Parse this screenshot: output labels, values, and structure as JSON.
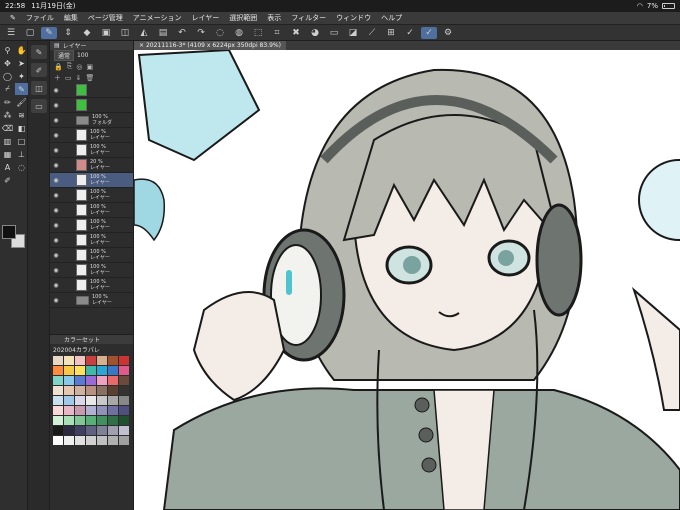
{
  "status_bar": {
    "time": "22:58",
    "date": "11月19日(金)",
    "battery": "7%",
    "battery_level": 0.07
  },
  "menu": [
    "ファイル",
    "編集",
    "ページ管理",
    "アニメーション",
    "レイヤー",
    "選択範囲",
    "表示",
    "フィルター",
    "ウィンドウ",
    "ヘルプ"
  ],
  "layer_panel": {
    "title": "レイヤー",
    "blend_mode": "通常",
    "opacity": "100",
    "layers": [
      {
        "pct": "",
        "name": "",
        "kind": "green"
      },
      {
        "pct": "",
        "name": "",
        "kind": "green"
      },
      {
        "pct": "100 %",
        "name": "フォルダ",
        "kind": "folder"
      },
      {
        "pct": "100 %",
        "name": "レイヤー",
        "kind": "thumb"
      },
      {
        "pct": "100 %",
        "name": "レイヤー",
        "kind": "thumb"
      },
      {
        "pct": "20 %",
        "name": "レイヤー",
        "kind": "red"
      },
      {
        "pct": "100 %",
        "name": "レイヤー",
        "kind": "thumb",
        "active": true
      },
      {
        "pct": "100 %",
        "name": "レイヤー",
        "kind": "thumb"
      },
      {
        "pct": "100 %",
        "name": "レイヤー",
        "kind": "thumb"
      },
      {
        "pct": "100 %",
        "name": "レイヤー",
        "kind": "thumb"
      },
      {
        "pct": "100 %",
        "name": "レイヤー",
        "kind": "thumb"
      },
      {
        "pct": "100 %",
        "name": "レイヤー",
        "kind": "thumb"
      },
      {
        "pct": "100 %",
        "name": "レイヤー",
        "kind": "thumb"
      },
      {
        "pct": "100 %",
        "name": "レイヤー",
        "kind": "thumb"
      },
      {
        "pct": "100 %",
        "name": "レイヤー",
        "kind": "folder"
      }
    ]
  },
  "color_panel": {
    "title": "カラーセット",
    "set_name": "202004カラパレ",
    "chips": [
      "#e8d9c6",
      "#f4e2b8",
      "#f2c3c3",
      "#c94040",
      "#d8b090",
      "#a0522d",
      "#cc3333",
      "#ff8c3c",
      "#f7c948",
      "#ffe25a",
      "#40b8a8",
      "#2aa6d6",
      "#3a78c6",
      "#e05a8a",
      "#7fd6c8",
      "#88c8e8",
      "#5a7ad6",
      "#9a6ad6",
      "#f0a0c0",
      "#e86a6a",
      "#6a4a3a",
      "#f0e0d0",
      "#e6c8b0",
      "#d0b0a0",
      "#b89080",
      "#8a7060",
      "#5a4030",
      "#333333",
      "#c8e0f0",
      "#a0c8e8",
      "#d8d8e8",
      "#e8e8e8",
      "#c8c8c8",
      "#a8a8a8",
      "#888888",
      "#f8d8d8",
      "#e8b8c8",
      "#c89ab0",
      "#b0b0d0",
      "#9090b8",
      "#7070a0",
      "#505080",
      "#d0f0d8",
      "#a8e0b8",
      "#80c898",
      "#58b078",
      "#409060",
      "#307048",
      "#205030",
      "#1a1a1a",
      "#2a2a40",
      "#404060",
      "#606080",
      "#808098",
      "#a0a0b0",
      "#c0c0d0",
      "#ffffff",
      "#f0f0f0",
      "#e0e0e0",
      "#d0d0d0",
      "#c0c0c0",
      "#b0b0b0",
      "#a0a0a0"
    ]
  },
  "canvas": {
    "tab_title": "20211116-3* (4109 x 6224px 350dpi 83.9%)"
  },
  "colors": {
    "accent": "#4f6f9e",
    "hair": "#b8b9b0",
    "cyan": "#4fc3cf",
    "skin": "#f4ece6",
    "jacket": "#9aa8a0",
    "line": "#1a1a1a"
  }
}
